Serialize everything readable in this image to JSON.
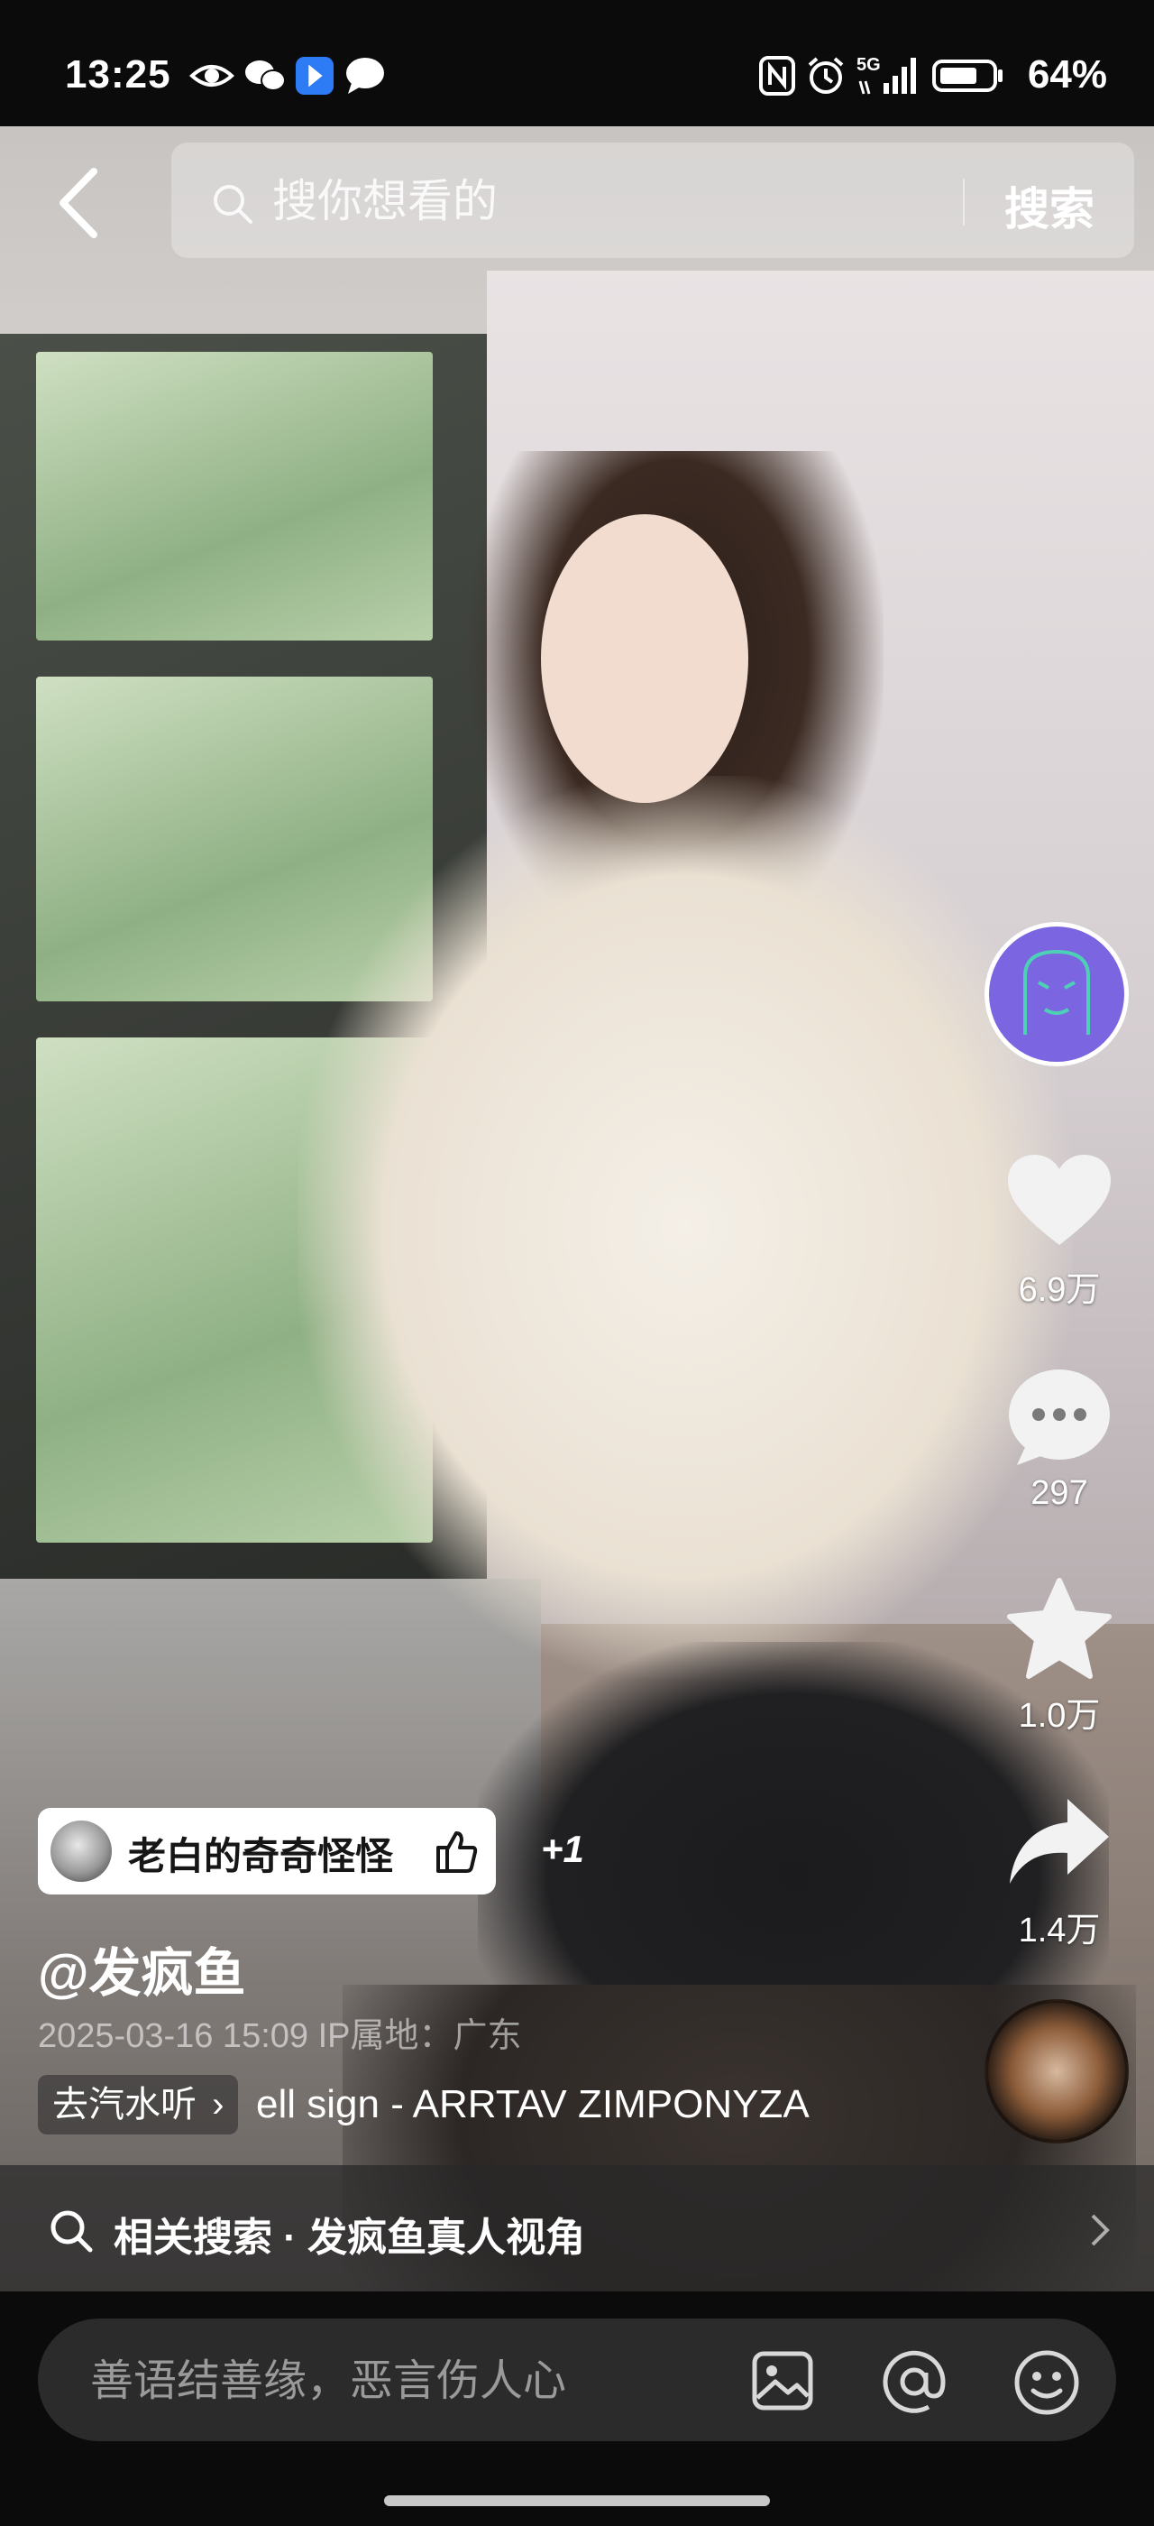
{
  "status_bar": {
    "time": "13:25",
    "left_icons": [
      "eye-icon",
      "wechat-icon",
      "app-badge-icon",
      "message-bubble-icon"
    ],
    "right_icons": [
      "nfc-icon",
      "alarm-icon",
      "5g-signal-icon",
      "battery-icon"
    ],
    "network": "5G",
    "battery_percent": "64%"
  },
  "search": {
    "placeholder": "搜你想看的",
    "button_label": "搜索"
  },
  "right_rail": {
    "likes": "6.9万",
    "comments": "297",
    "favorites": "1.0万",
    "shares": "1.4万"
  },
  "video_info": {
    "collab_user": "老白的奇奇怪怪",
    "collab_more": "+1",
    "author_handle": "@发疯鱼",
    "post_meta": "2025-03-16 15:09 IP属地：广东",
    "music_chip": "去汽水听",
    "music_name": "ell sign - ARRTAV ZIMPONYZA"
  },
  "related_search": {
    "text": "相关搜索 · 发疯鱼真人视角"
  },
  "comment_bar": {
    "placeholder": "善语结善缘，恶言伤人心"
  },
  "colors": {
    "background": "#0b0b0b",
    "author_avatar": "#7b65e0",
    "comment_box": "#2b2b2b"
  }
}
